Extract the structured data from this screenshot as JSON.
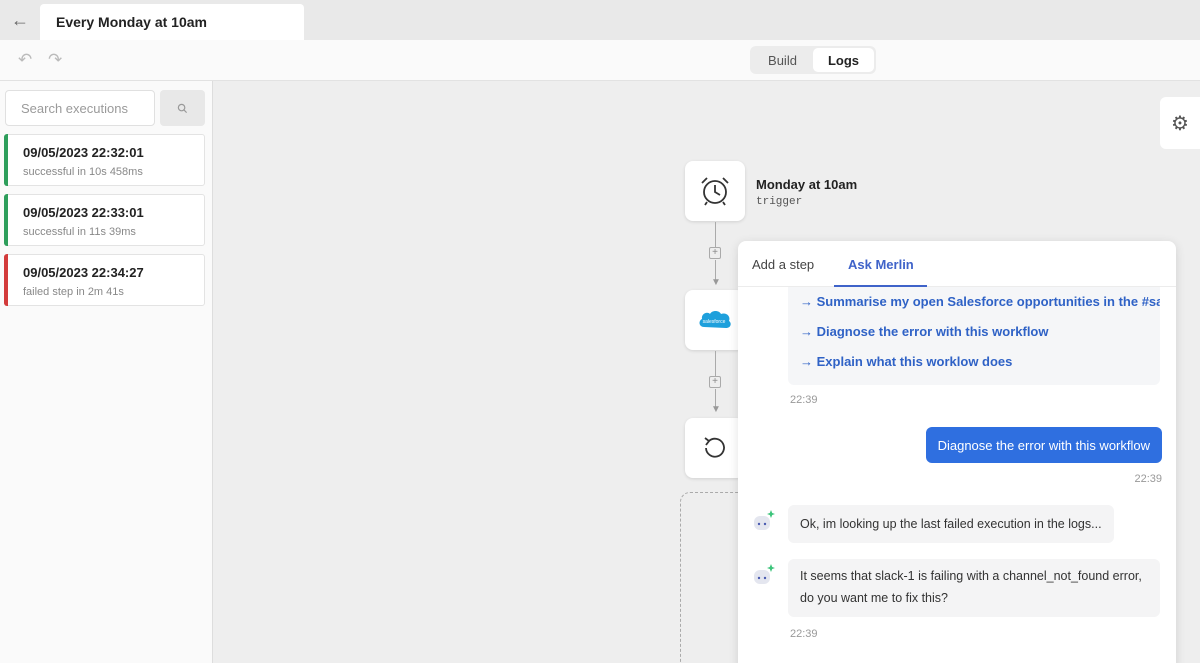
{
  "window": {
    "title": "Every Monday at 10am",
    "back_icon": "arrow-left-icon"
  },
  "toolbar": {
    "undo_icon": "undo-icon",
    "redo_icon": "redo-icon",
    "modes": [
      {
        "label": "Build",
        "active": false
      },
      {
        "label": "Logs",
        "active": true
      }
    ]
  },
  "sidebar": {
    "search": {
      "placeholder": "Search executions",
      "value": ""
    },
    "executions": [
      {
        "timestamp": "09/05/2023 22:32:01",
        "status": "successful in 10s 458ms",
        "result": "success"
      },
      {
        "timestamp": "09/05/2023 22:33:01",
        "status": "successful in 11s 39ms",
        "result": "success"
      },
      {
        "timestamp": "09/05/2023 22:34:27",
        "status": "failed step in 2m 41s",
        "result": "failed"
      }
    ]
  },
  "workflow": {
    "trigger": {
      "title": "Monday at 10am",
      "subtitle": "trigger",
      "icon": "alarm-clock-icon"
    },
    "steps": [
      {
        "icon": "salesforce-icon",
        "logo_text": "salesforce"
      },
      {
        "icon": "loop-icon"
      }
    ]
  },
  "assistant": {
    "tabs": [
      {
        "label": "Add a step",
        "active": false
      },
      {
        "label": "Ask Merlin",
        "active": true
      }
    ],
    "suggestions": [
      "Summarise my open Salesforce opportunities in the #sale",
      "Diagnose the error with this workflow",
      "Explain what this worklow does"
    ],
    "suggestions_time": "22:39",
    "messages": [
      {
        "from": "user",
        "text": "Diagnose the error with this workflow",
        "time": "22:39"
      },
      {
        "from": "bot",
        "text": "Ok, im looking up the last failed execution in the logs..."
      },
      {
        "from": "bot",
        "text": "It seems that slack-1 is failing with a channel_not_found error, do you want me to fix this?",
        "time": "22:39"
      }
    ]
  },
  "colors": {
    "success": "#2e9e5b",
    "failed": "#d33b3b",
    "accent": "#3f63c9",
    "user_bubble": "#2f6fe0"
  }
}
